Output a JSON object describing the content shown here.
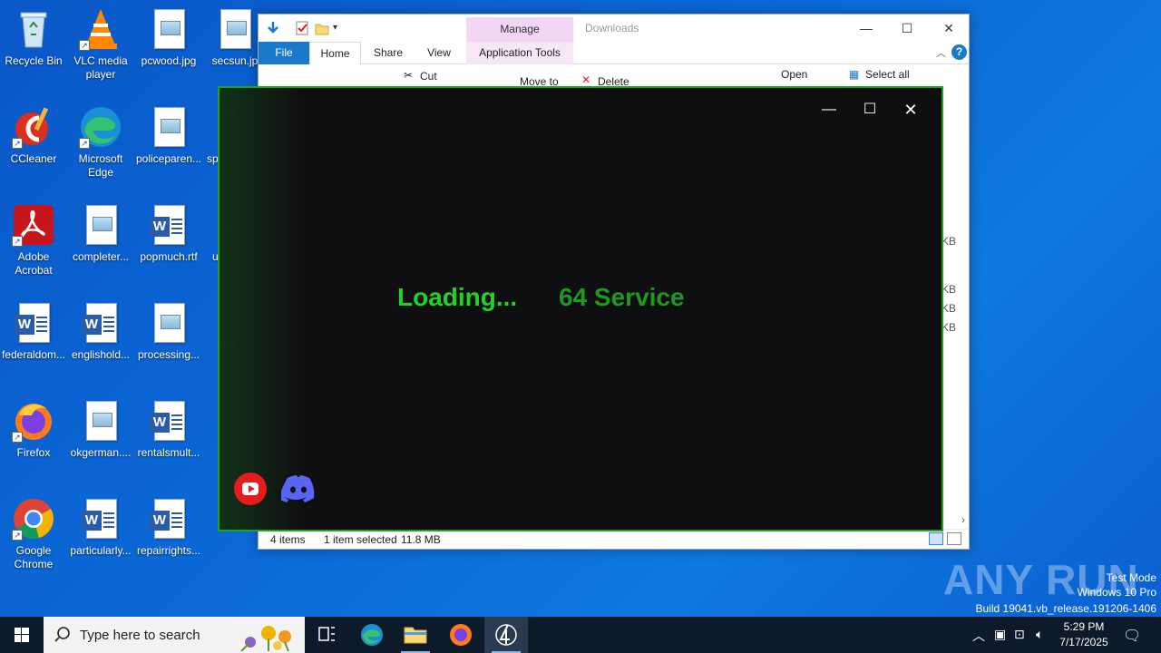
{
  "desktop": {
    "icons": [
      {
        "label": "Recycle Bin"
      },
      {
        "label": "VLC media player"
      },
      {
        "label": "pcwood.jpg"
      },
      {
        "label": "secsun.jp"
      },
      {
        "label": "CCleaner"
      },
      {
        "label": "Microsoft Edge"
      },
      {
        "label": "policeparen..."
      },
      {
        "label": "sp"
      },
      {
        "label": "Adobe Acrobat"
      },
      {
        "label": "completer..."
      },
      {
        "label": "popmuch.rtf"
      },
      {
        "label": "u"
      },
      {
        "label": "federaldom..."
      },
      {
        "label": "englishold..."
      },
      {
        "label": "processing..."
      },
      {
        "label": "Firefox"
      },
      {
        "label": "okgerman...."
      },
      {
        "label": "rentalsmult..."
      },
      {
        "label": "Google Chrome"
      },
      {
        "label": "particularly..."
      },
      {
        "label": "repairrights..."
      }
    ]
  },
  "explorer": {
    "title": "Downloads",
    "manage_tab": "Manage",
    "tabs": {
      "file": "File",
      "home": "Home",
      "share": "Share",
      "view": "View",
      "app_tools": "Application Tools"
    },
    "ribbon": {
      "cut": "Cut",
      "move_to": "Move to",
      "delete": "Delete",
      "open": "Open",
      "select_all": "Select all"
    },
    "sizes": [
      "KB",
      "KB",
      "KB",
      "KB"
    ],
    "status": {
      "items": "4 items",
      "selected": "1 item selected",
      "size": "11.8 MB"
    }
  },
  "loader": {
    "loading_text": "Loading...",
    "service_text": "64 Service",
    "colors": {
      "border": "#1aa51a",
      "loading": "#22d422",
      "service": "#1d9a1d"
    }
  },
  "watermark": {
    "brand": "ANY RUN",
    "mode": "Test Mode",
    "edition": "Windows 10 Pro",
    "build": "Build 19041.vb_release.191206-1406"
  },
  "taskbar": {
    "search_placeholder": "Type here to search",
    "time": "5:29 PM",
    "date": "7/17/2025"
  }
}
